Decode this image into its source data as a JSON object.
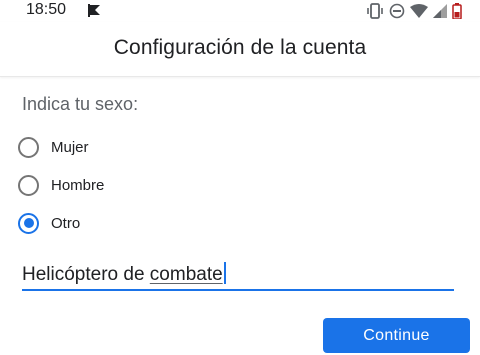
{
  "status_bar": {
    "time": "18:50",
    "icons": [
      "notification-flag-icon",
      "vibrate-icon",
      "do-not-disturb-icon",
      "wifi-icon",
      "signal-icon",
      "battery-icon"
    ],
    "battery_color": "#b71c1c"
  },
  "app_bar": {
    "title": "Configuración de la cuenta"
  },
  "form": {
    "question": "Indica tu sexo:",
    "options": [
      {
        "label": "Mujer",
        "selected": false
      },
      {
        "label": "Hombre",
        "selected": false
      },
      {
        "label": "Otro",
        "selected": true
      }
    ],
    "other_input": {
      "value_part1": "Helicóptero de ",
      "value_part2": "combate"
    }
  },
  "actions": {
    "continue_label": "Continue"
  },
  "colors": {
    "accent": "#1a73e8",
    "text": "#202124",
    "secondary_text": "#5f6368"
  }
}
